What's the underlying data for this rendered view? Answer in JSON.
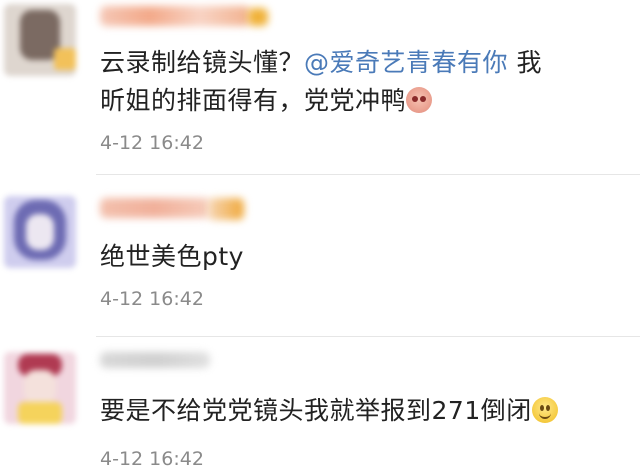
{
  "comments": [
    {
      "text_before": "云录制给镜头懂？",
      "mention": "@爱奇艺青春有你",
      "text_after": " 我",
      "line2": "昕姐的排面得有，党党冲鸭",
      "emoji": "pink-face-emoji-icon",
      "time": "4-12 16:42",
      "avatar_colors": [
        "#c9b7a8",
        "#7b6a62",
        "#f2c15a"
      ]
    },
    {
      "text": "绝世美色pty",
      "time": "4-12 16:42",
      "avatar_colors": [
        "#a7a4d6",
        "#6d6bb3",
        "#e8e6f6"
      ]
    },
    {
      "text": "要是不给党党镜头我就举报到271倒闭",
      "emoji": "smile-emoji-icon",
      "time": "4-12 16:42",
      "avatar_colors": [
        "#e7b6c6",
        "#b03a52",
        "#f5d35c"
      ]
    }
  ]
}
